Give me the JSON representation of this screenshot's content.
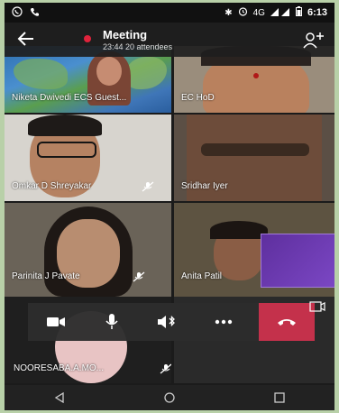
{
  "status_bar": {
    "time": "6:13",
    "network": "4G"
  },
  "header": {
    "title": "Meeting",
    "subtitle": "23:44  20 attendees"
  },
  "participants": [
    {
      "name": "Niketa Dwivedi ECS Guest..."
    },
    {
      "name": "EC HoD"
    },
    {
      "name": "Omkar D Shreyakar"
    },
    {
      "name": "Sridhar  Iyer"
    },
    {
      "name": "Parinita J Pavate"
    },
    {
      "name": "Anita  Patil"
    },
    {
      "name": "NOORESABA.A.MO..."
    }
  ],
  "colors": {
    "hangup": "#c4314b",
    "callbar": "#2d2d2d"
  }
}
